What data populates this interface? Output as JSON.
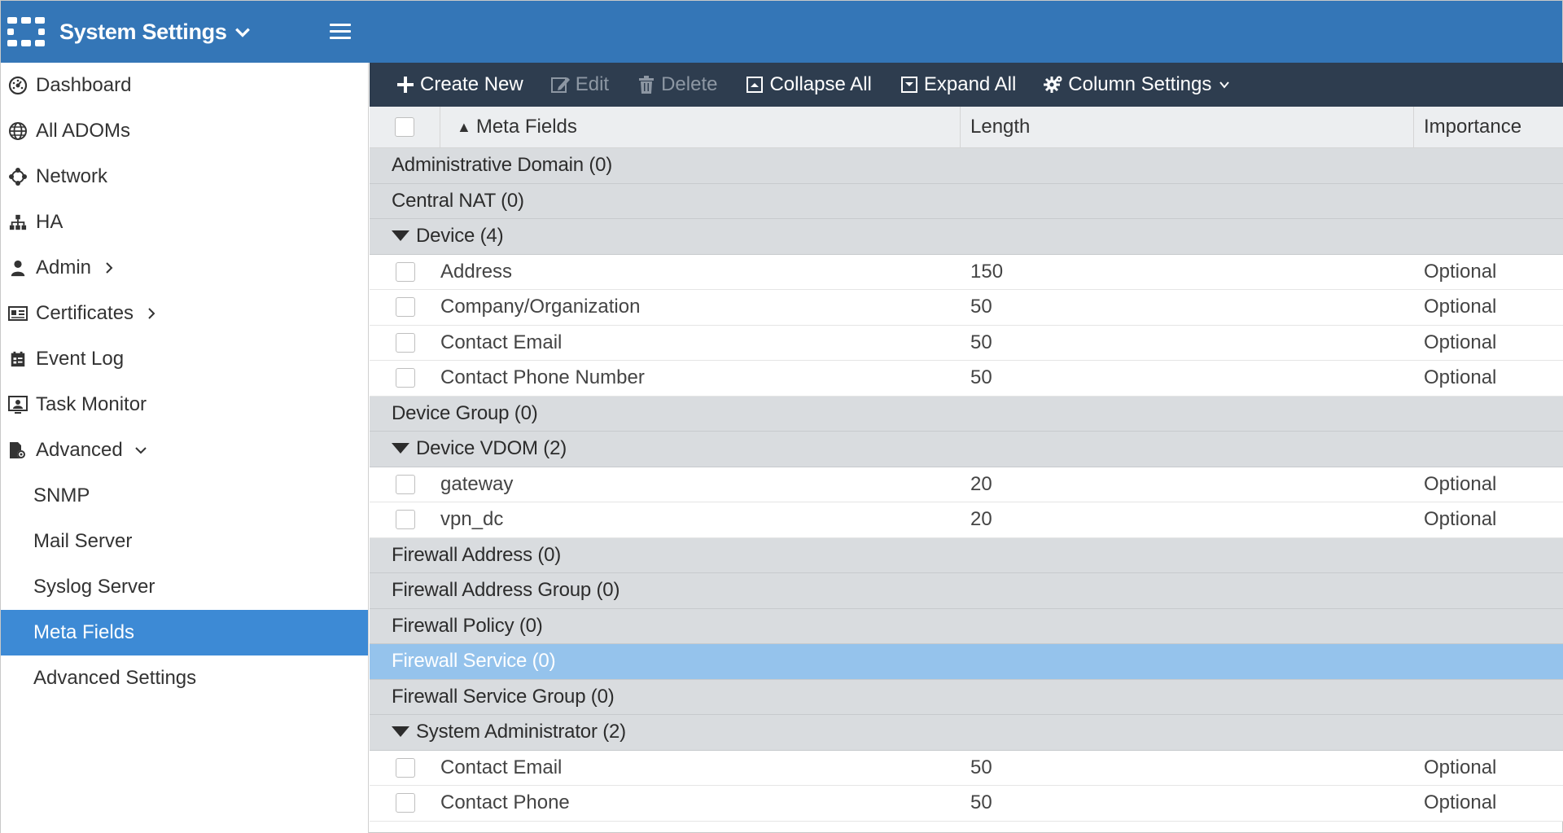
{
  "header": {
    "title": "System Settings",
    "brand_color": "#3476b7"
  },
  "sidebar": {
    "items": [
      {
        "label": "Dashboard",
        "icon": "dashboard-icon"
      },
      {
        "label": "All ADOMs",
        "icon": "globe-icon"
      },
      {
        "label": "Network",
        "icon": "network-icon"
      },
      {
        "label": "HA",
        "icon": "sitemap-icon"
      },
      {
        "label": "Admin",
        "icon": "user-icon"
      },
      {
        "label": "Certificates",
        "icon": "certificate-icon"
      },
      {
        "label": "Event Log",
        "icon": "event-log-icon"
      },
      {
        "label": "Task Monitor",
        "icon": "task-monitor-icon"
      },
      {
        "label": "Advanced",
        "icon": "advanced-icon"
      }
    ],
    "sub_items": [
      {
        "label": "SNMP"
      },
      {
        "label": "Mail Server"
      },
      {
        "label": "Syslog Server"
      },
      {
        "label": "Meta Fields",
        "active": true
      },
      {
        "label": "Advanced Settings"
      }
    ],
    "active_color": "#3d8ad5"
  },
  "toolbar": {
    "create_new": "Create New",
    "edit": "Edit",
    "delete": "Delete",
    "collapse_all": "Collapse All",
    "expand_all": "Expand All",
    "column_settings": "Column Settings"
  },
  "table": {
    "columns": {
      "name": "Meta Fields",
      "length": "Length",
      "importance": "Importance"
    },
    "groups": {
      "g0": "Administrative Domain (0)",
      "g1": "Central NAT (0)",
      "g2": "Device (4)",
      "g3": "Device Group (0)",
      "g4": "Device VDOM (2)",
      "g5": "Firewall Address (0)",
      "g6": "Firewall Address Group (0)",
      "g7": "Firewall Policy (0)",
      "g8": "Firewall Service (0)",
      "g9": "Firewall Service Group (0)",
      "g10": "System Administrator (2)"
    },
    "device_rows": [
      {
        "name": "Address",
        "length": "150",
        "importance": "Optional"
      },
      {
        "name": "Company/Organization",
        "length": "50",
        "importance": "Optional"
      },
      {
        "name": "Contact Email",
        "length": "50",
        "importance": "Optional"
      },
      {
        "name": "Contact Phone Number",
        "length": "50",
        "importance": "Optional"
      }
    ],
    "vdom_rows": [
      {
        "name": "gateway",
        "length": "20",
        "importance": "Optional"
      },
      {
        "name": "vpn_dc",
        "length": "20",
        "importance": "Optional"
      }
    ],
    "admin_rows": [
      {
        "name": "Contact Email",
        "length": "50",
        "importance": "Optional"
      },
      {
        "name": "Contact Phone",
        "length": "50",
        "importance": "Optional"
      }
    ],
    "selected_color": "#95c3ec"
  }
}
